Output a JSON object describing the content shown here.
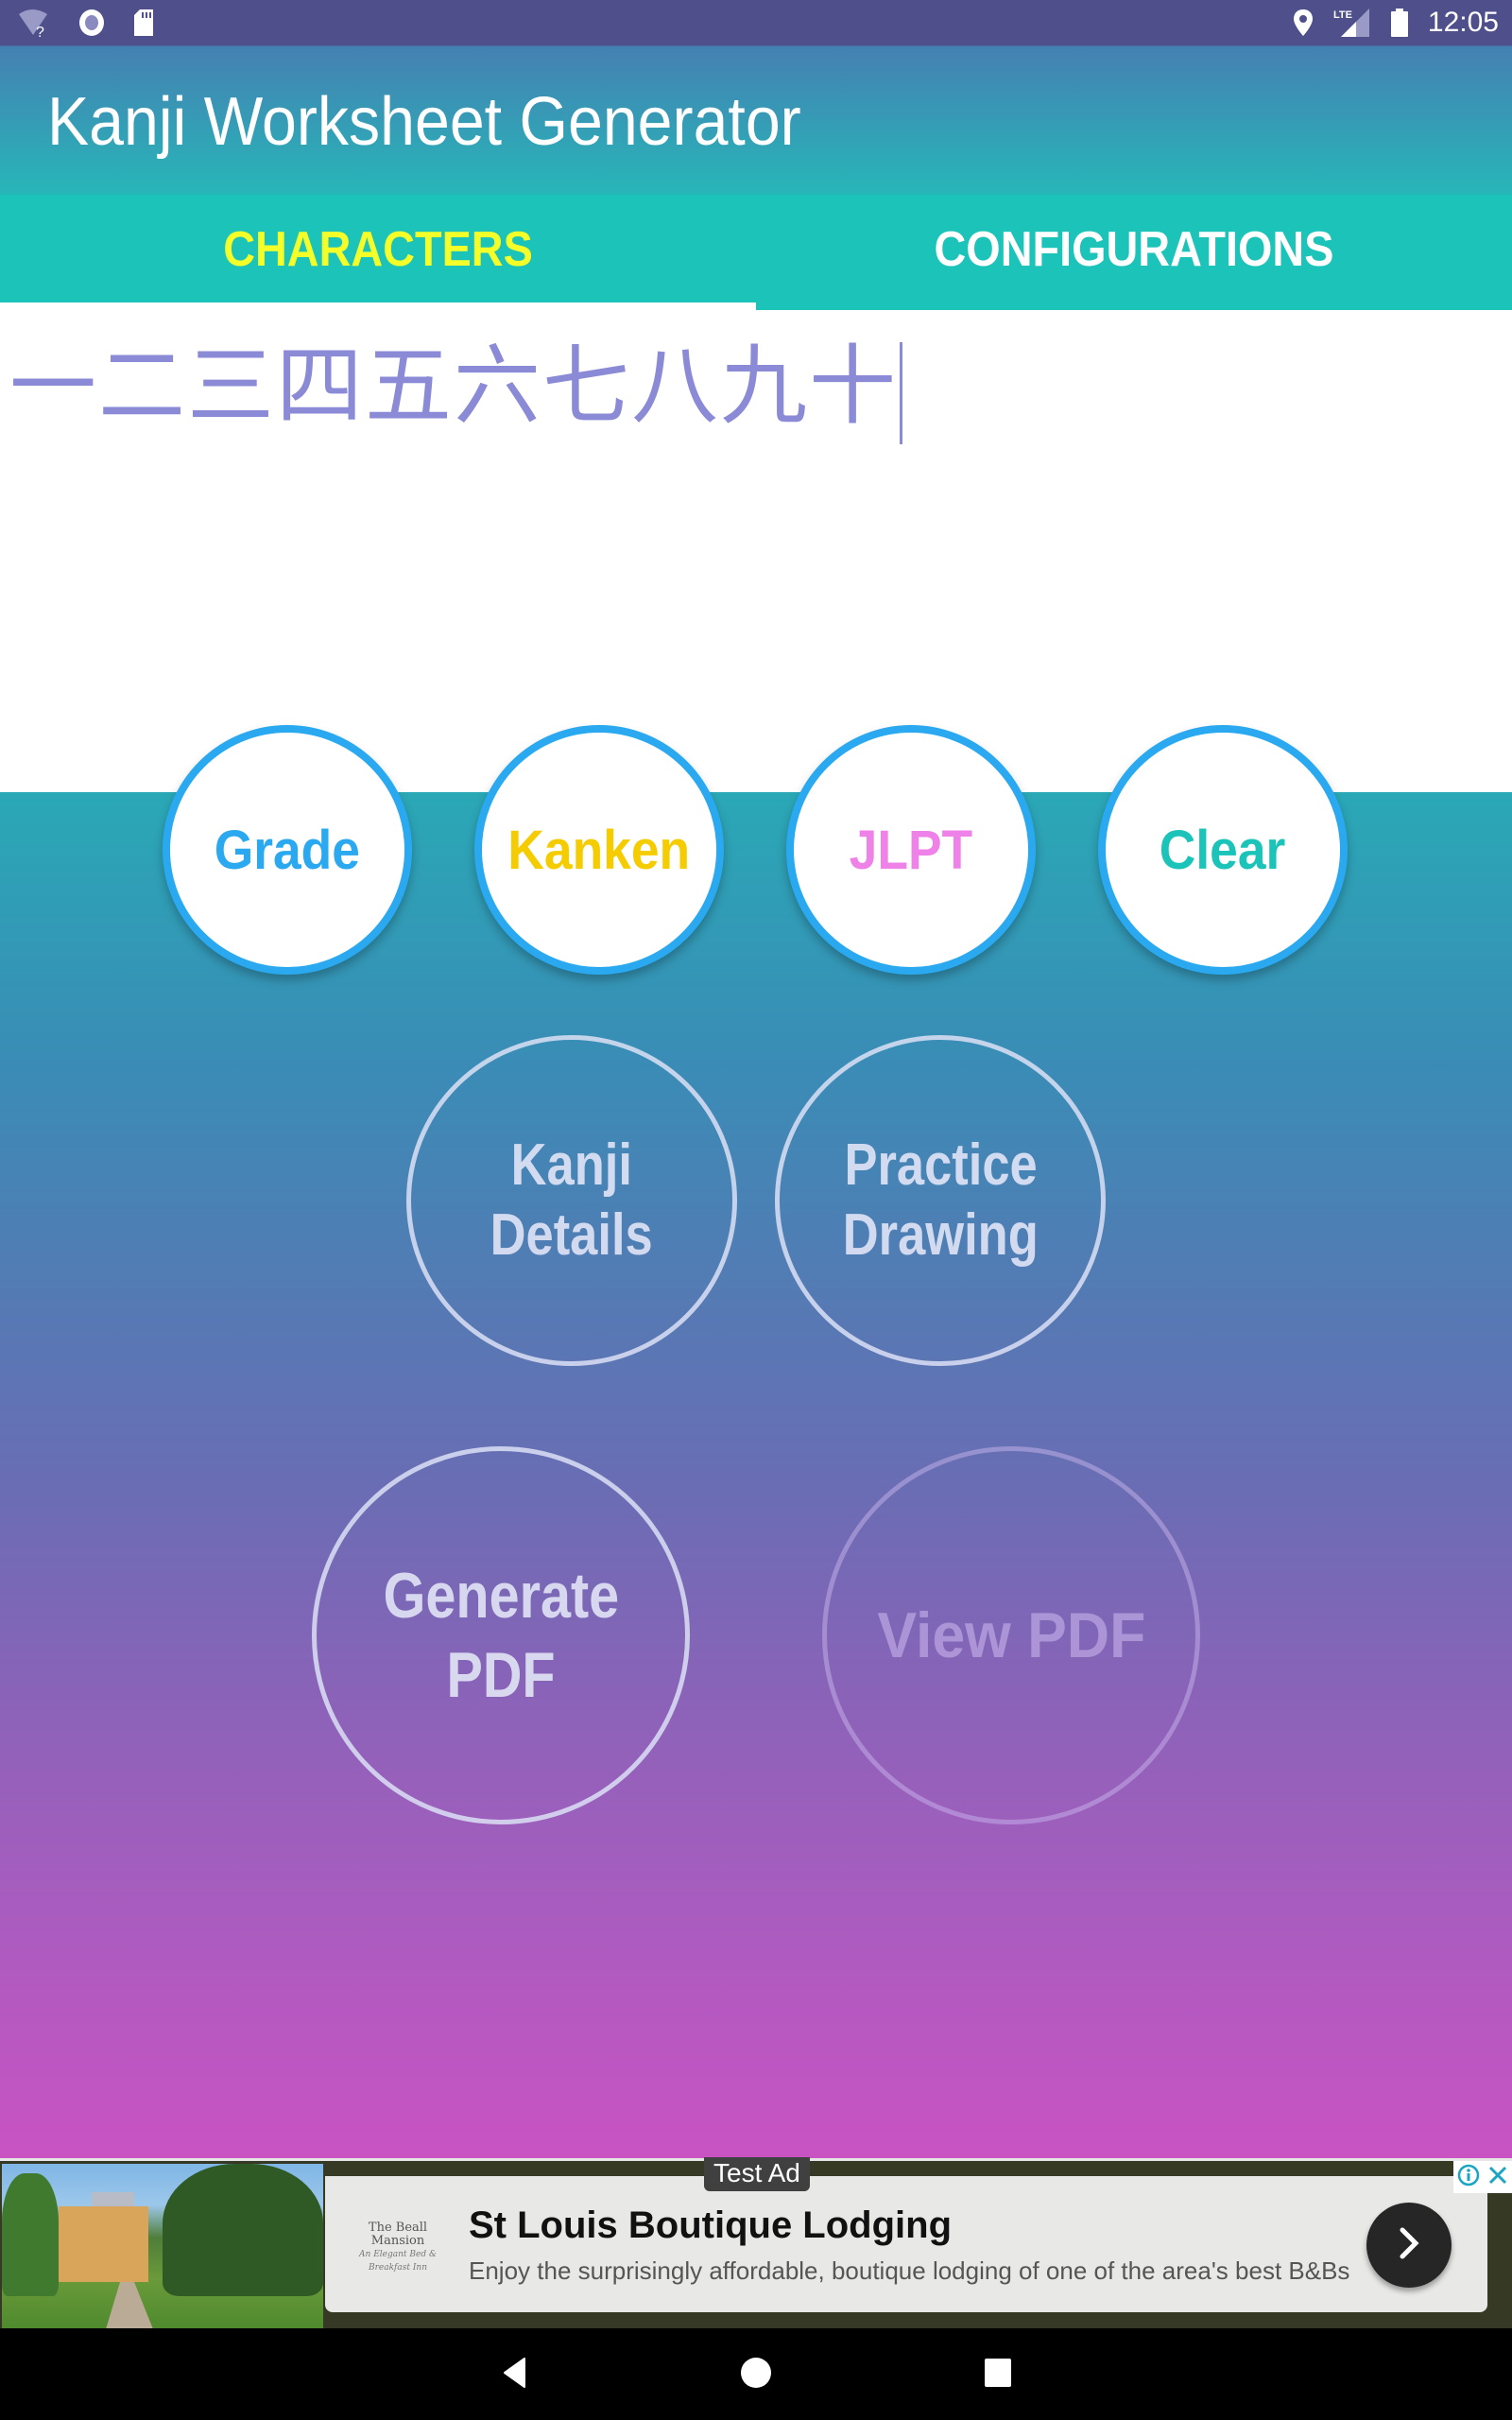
{
  "status_bar": {
    "time": "12:05",
    "left_icons": [
      "wifi-unknown-icon",
      "recording-icon",
      "sd-card-icon"
    ],
    "right_icons": [
      "location-icon",
      "lte-signal-icon",
      "battery-icon"
    ],
    "network_label": "LTE"
  },
  "app_bar": {
    "title": "Kanji Worksheet Generator"
  },
  "tabs": [
    {
      "label": "CHARACTERS",
      "active": true
    },
    {
      "label": "CONFIGURATIONS",
      "active": false
    }
  ],
  "colors": {
    "active_tab_text": "#f4ff2a",
    "tab_bg": "#1cc3b8",
    "kanji_text": "#8a8ad6",
    "circle_border": "#2aa9f0",
    "grade": "#2aa9f0",
    "kanken": "#f5cc00",
    "jlpt": "#ee82e8",
    "clear": "#1cc3b8"
  },
  "input": {
    "value": "一二三四五六七八九十"
  },
  "quick_buttons": [
    {
      "label": "Grade"
    },
    {
      "label": "Kanken"
    },
    {
      "label": "JLPT"
    },
    {
      "label": "Clear"
    }
  ],
  "action_buttons": {
    "kanji_details": {
      "line1": "Kanji",
      "line2": "Details"
    },
    "practice_drawing": {
      "line1": "Practice",
      "line2": "Drawing"
    },
    "generate_pdf": {
      "line1": "Generate",
      "line2": "PDF"
    },
    "view_pdf": {
      "label": "View PDF",
      "enabled": false
    }
  },
  "ad": {
    "badge": "Test Ad",
    "logo_line1": "The Beall Mansion",
    "logo_line2": "An Elegant Bed & Breakfast Inn",
    "title": "St Louis Boutique Lodging",
    "body": "Enjoy the surprisingly affordable, boutique lodging of one of the area's best B&Bs"
  },
  "nav_bar": {
    "buttons": [
      "back",
      "home",
      "recents"
    ]
  }
}
